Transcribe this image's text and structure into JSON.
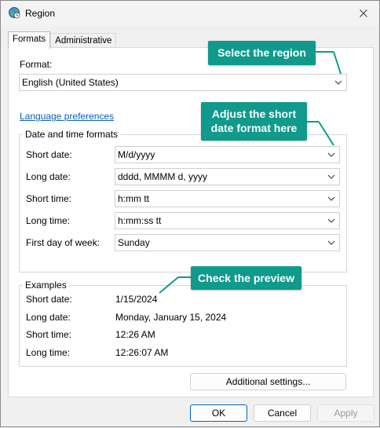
{
  "window": {
    "title": "Region"
  },
  "tabs": [
    {
      "label": "Formats",
      "active": true
    },
    {
      "label": "Administrative",
      "active": false
    }
  ],
  "format": {
    "label": "Format:",
    "value": "English (United States)"
  },
  "language_link": "Language preferences",
  "datetime_group": {
    "title": "Date and time formats",
    "rows": [
      {
        "label": "Short date:",
        "value": "M/d/yyyy"
      },
      {
        "label": "Long date:",
        "value": "dddd, MMMM d, yyyy"
      },
      {
        "label": "Short time:",
        "value": "h:mm tt"
      },
      {
        "label": "Long time:",
        "value": "h:mm:ss tt"
      },
      {
        "label": "First day of week:",
        "value": "Sunday"
      }
    ]
  },
  "examples_group": {
    "title": "Examples",
    "rows": [
      {
        "label": "Short date:",
        "value": "1/15/2024"
      },
      {
        "label": "Long date:",
        "value": "Monday, January 15, 2024"
      },
      {
        "label": "Short time:",
        "value": "12:26 AM"
      },
      {
        "label": "Long time:",
        "value": "12:26:07 AM"
      }
    ]
  },
  "buttons": {
    "additional": "Additional settings...",
    "ok": "OK",
    "cancel": "Cancel",
    "apply": "Apply"
  },
  "callouts": {
    "region": "Select the region",
    "short_date_line1": "Adjust the short",
    "short_date_line2": "date format here",
    "preview": "Check the preview"
  },
  "colors": {
    "callout": "#0f9a8c",
    "link": "#0a5fb5",
    "primary_border": "#0067c0"
  },
  "icons": {
    "title": "globe-clock-icon",
    "close": "close-icon",
    "dropdown": "chevron-down-icon"
  }
}
